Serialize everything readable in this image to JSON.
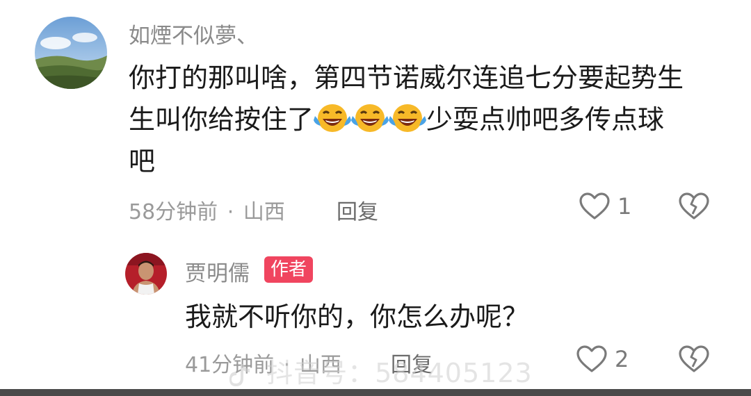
{
  "comment": {
    "username": "如煙不似夢、",
    "text_line1": "你打的那叫啥，第四节诺威尔连追七分要起势生",
    "text_line2_start": "生叫你给按住了",
    "text_line2_end": "少耍点帅吧多传点球",
    "text_line3": "吧",
    "emoji": "laugh-cry-emoji",
    "time": "58分钟前",
    "dot": "·",
    "location": "山西",
    "reply_label": "回复",
    "like_count": "1"
  },
  "reply": {
    "username": "贾明儒",
    "badge": "作者",
    "text": "我就不听你的，你怎么办呢？",
    "time": "41分钟前",
    "dot": "·",
    "location": "山西",
    "reply_label": "回复",
    "like_count": "2"
  },
  "watermark": {
    "text": "抖音号：584405123"
  },
  "colors": {
    "author_badge": "#f0455f",
    "emoji_yellow": "#f7b928",
    "tears_blue": "#4aa3e6"
  }
}
